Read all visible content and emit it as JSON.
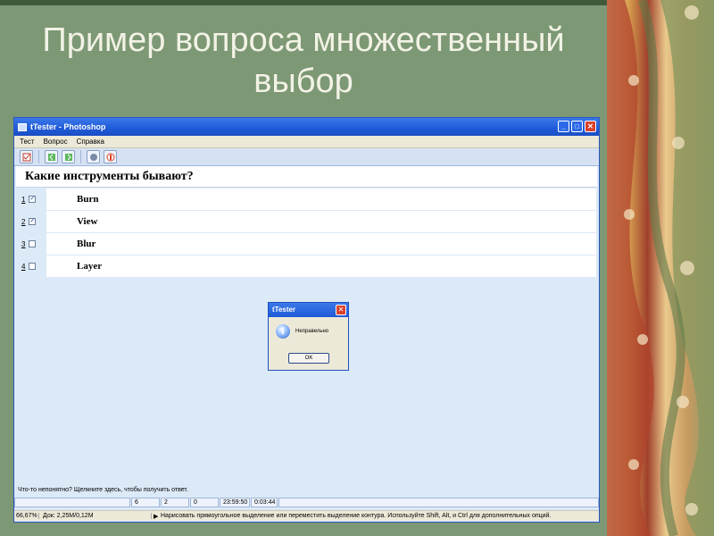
{
  "slide": {
    "title_line1": "Пример вопроса множественный",
    "title_line2": "выбор"
  },
  "window": {
    "title": "tTester - Photoshop",
    "min": "_",
    "max": "□",
    "close": "✕"
  },
  "menu": [
    "Тест",
    "Вопрос",
    "Справка"
  ],
  "question": "Какие инструменты бывают?",
  "answers": [
    {
      "num": "1",
      "text": "Burn",
      "checked": true
    },
    {
      "num": "2",
      "text": "View",
      "checked": true
    },
    {
      "num": "3",
      "text": "Blur",
      "checked": false
    },
    {
      "num": "4",
      "text": "Layer",
      "checked": false
    }
  ],
  "check_mark": "✓",
  "hint": "Что-то непонятно? Щелкните здесь, чтобы получить ответ.",
  "status": {
    "s1": "6",
    "s2": "2",
    "s3": "0",
    "s4": "23:59:50",
    "s5": "0:03:44"
  },
  "bottombar": {
    "zoom": "66,67%",
    "doc": "Док: 2,25M/0,12M",
    "message": "Нарисовать прямоугольное выделение или переместить выделение контура. Используйте Shift, Alt, и Ctrl для дополнительных опций."
  },
  "dialog": {
    "title": "tTester",
    "icon": "i",
    "text": "Неправельно",
    "ok": "OK",
    "close": "✕"
  }
}
